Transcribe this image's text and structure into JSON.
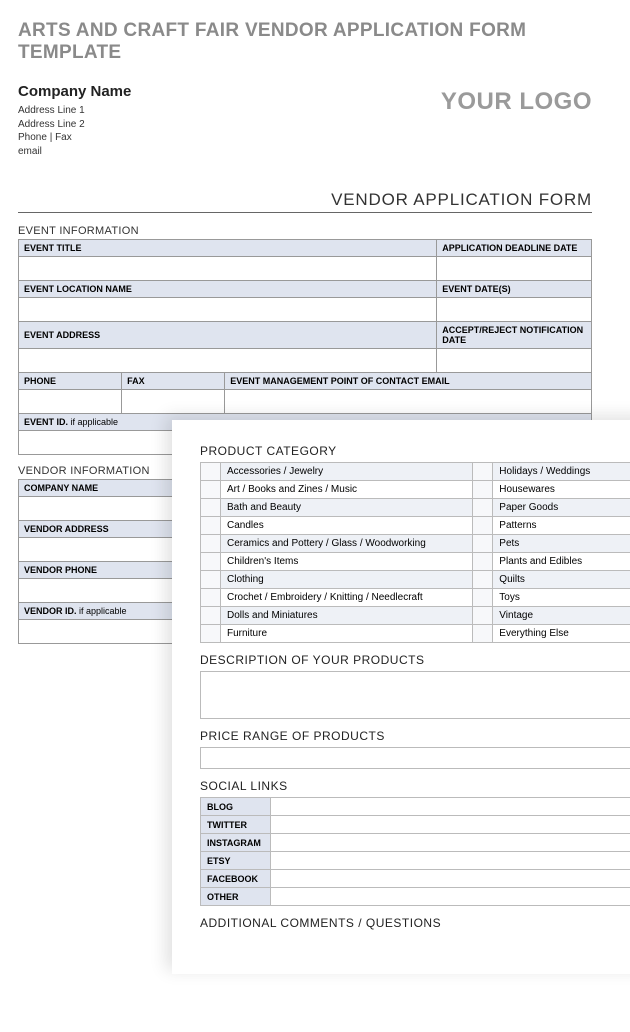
{
  "title": "ARTS AND CRAFT FAIR VENDOR APPLICATION FORM TEMPLATE",
  "company": {
    "name": "Company Name",
    "addr1": "Address Line 1",
    "addr2": "Address Line 2",
    "phonefax": "Phone  |  Fax",
    "email": "email"
  },
  "logo": "YOUR LOGO",
  "form_title": "VENDOR APPLICATION FORM",
  "sections": {
    "event": "EVENT INFORMATION",
    "vendor": "VENDOR INFORMATION",
    "product_cat": "PRODUCT CATEGORY",
    "description": "DESCRIPTION OF YOUR PRODUCTS",
    "price_range": "PRICE RANGE OF PRODUCTS",
    "social": "SOCIAL LINKS",
    "comments": "ADDITIONAL COMMENTS / QUESTIONS"
  },
  "event_fields": {
    "title": "EVENT TITLE",
    "deadline": "APPLICATION DEADLINE DATE",
    "location": "EVENT LOCATION NAME",
    "dates": "EVENT DATE(S)",
    "address": "EVENT ADDRESS",
    "notify": "ACCEPT/REJECT NOTIFICATION DATE",
    "phone": "PHONE",
    "fax": "FAX",
    "contact_email": "EVENT MANAGEMENT POINT OF CONTACT EMAIL",
    "event_id": "EVENT ID.",
    "if_applicable": " if applicable"
  },
  "vendor_fields": {
    "company": "COMPANY NAME",
    "address": "VENDOR ADDRESS",
    "phone": "VENDOR PHONE",
    "vendor_id": "VENDOR ID.",
    "if_applicable": " if applicable"
  },
  "categories_left": [
    "Accessories / Jewelry",
    "Art / Books and Zines / Music",
    "Bath and Beauty",
    "Candles",
    "Ceramics and Pottery / Glass / Woodworking",
    "Children's Items",
    "Clothing",
    "Crochet / Embroidery / Knitting / Needlecraft",
    "Dolls and Miniatures",
    "Furniture"
  ],
  "categories_right": [
    "Holidays / Weddings",
    "Housewares",
    "Paper Goods",
    "Patterns",
    "Pets",
    "Plants and Edibles",
    "Quilts",
    "Toys",
    "Vintage",
    "Everything Else"
  ],
  "social_links": [
    "BLOG",
    "TWITTER",
    "INSTAGRAM",
    "ETSY",
    "FACEBOOK",
    "OTHER"
  ]
}
